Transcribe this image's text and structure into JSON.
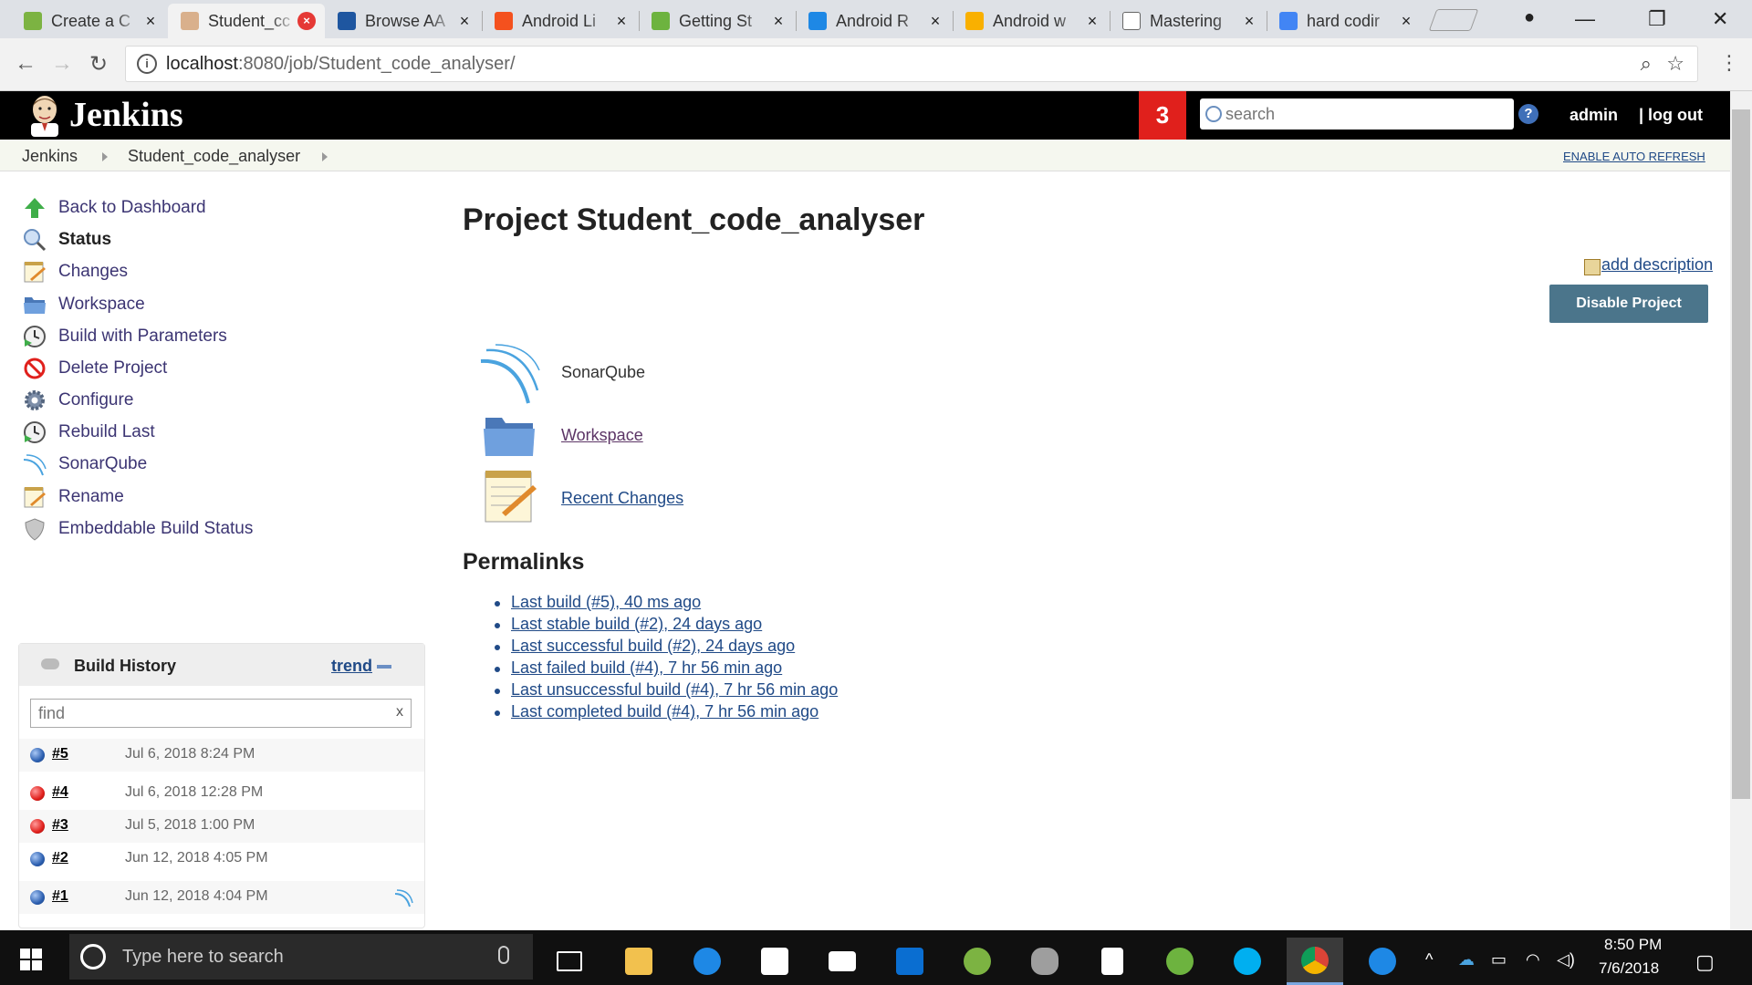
{
  "browser": {
    "tabs": [
      {
        "title": "Create a C",
        "icon_color": "#7cb342",
        "close": "×"
      },
      {
        "title": "Student_cc",
        "icon_color": "#d9b08c",
        "close": "×",
        "active": true
      },
      {
        "title": "Browse AA",
        "icon_color": "#1e56a0",
        "close": "×"
      },
      {
        "title": "Android Li",
        "icon_color": "#f4511e",
        "close": "×"
      },
      {
        "title": "Getting St",
        "icon_color": "#6db33f",
        "close": "×"
      },
      {
        "title": "Android R",
        "icon_color": "#1e88e5",
        "close": "×"
      },
      {
        "title": "Android w",
        "icon_color": "#f9b000",
        "close": "×"
      },
      {
        "title": "Mastering",
        "icon_color": "#ffffff",
        "close": "×"
      },
      {
        "title": "hard codir",
        "icon_color": "#4285f4",
        "close": "×"
      }
    ],
    "url_host": "localhost",
    "url_path": ":8080/job/Student_code_analyser/"
  },
  "jenkins": {
    "title": "Jenkins",
    "notification_count": "3",
    "search_placeholder": "search",
    "help": "?",
    "user": "admin",
    "logout": "| log out"
  },
  "breadcrumb": {
    "items": [
      "Jenkins",
      "Student_code_analyser"
    ],
    "auto_refresh": "ENABLE AUTO REFRESH"
  },
  "sidebar": {
    "tasks": [
      {
        "label": "Back to Dashboard",
        "icon": "up-arrow-icon"
      },
      {
        "label": "Status",
        "icon": "search-icon"
      },
      {
        "label": "Changes",
        "icon": "notepad-icon"
      },
      {
        "label": "Workspace",
        "icon": "folder-icon"
      },
      {
        "label": "Build with Parameters",
        "icon": "clock-play-icon"
      },
      {
        "label": "Delete Project",
        "icon": "no-entry-icon"
      },
      {
        "label": "Configure",
        "icon": "gear-icon"
      },
      {
        "label": "Rebuild Last",
        "icon": "clock-play-icon"
      },
      {
        "label": "SonarQube",
        "icon": "sonarqube-icon"
      },
      {
        "label": "Rename",
        "icon": "notepad-icon"
      },
      {
        "label": "Embeddable Build Status",
        "icon": "shield-icon"
      }
    ]
  },
  "build_history": {
    "title": "Build History",
    "trend": "trend",
    "find_placeholder": "find",
    "clear": "x",
    "builds": [
      {
        "num": "#5",
        "date": "Jul 6, 2018 8:24 PM",
        "status": "blue"
      },
      {
        "num": "#4",
        "date": "Jul 6, 2018 12:28 PM",
        "status": "red"
      },
      {
        "num": "#3",
        "date": "Jul 5, 2018 1:00 PM",
        "status": "red"
      },
      {
        "num": "#2",
        "date": "Jun 12, 2018 4:05 PM",
        "status": "blue"
      },
      {
        "num": "#1",
        "date": "Jun 12, 2018 4:04 PM",
        "status": "blue"
      }
    ]
  },
  "main": {
    "title": "Project Student_code_analyser",
    "add_description": "add description",
    "disable_button": "Disable Project",
    "links": {
      "sonarqube": "SonarQube",
      "workspace": "Workspace",
      "recent_changes": "Recent Changes"
    },
    "permalinks_heading": "Permalinks",
    "permalinks": [
      "Last build (#5), 40 ms ago",
      "Last stable build (#2), 24 days ago",
      "Last successful build (#2), 24 days ago",
      "Last failed build (#4), 7 hr 56 min ago",
      "Last unsuccessful build (#4), 7 hr 56 min ago",
      "Last completed build (#4), 7 hr 56 min ago"
    ]
  },
  "taskbar": {
    "search_placeholder": "Type here to search",
    "time": "8:50 PM",
    "date": "7/6/2018"
  }
}
